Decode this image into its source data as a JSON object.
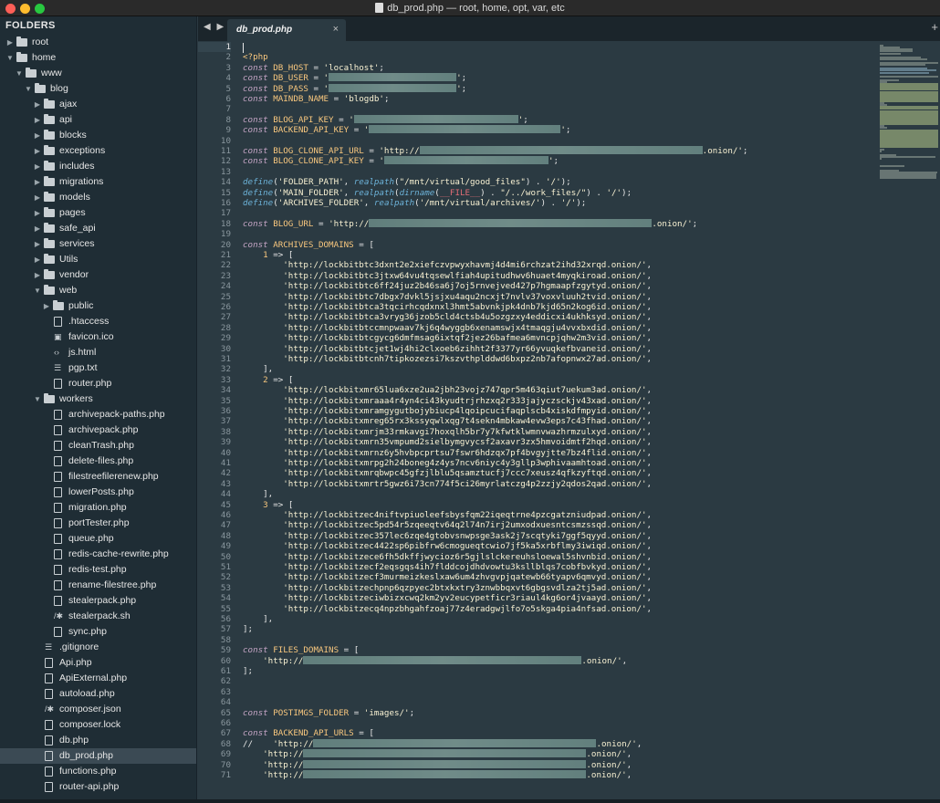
{
  "window": {
    "title": "db_prod.php — root, home, opt, var, etc",
    "traffic_lights": {
      "close": "#fe5f57",
      "minimize": "#febc2e",
      "zoom": "#28c840"
    }
  },
  "sidebar": {
    "header": "FOLDERS",
    "tree": [
      {
        "label": "root",
        "kind": "folder",
        "open": false,
        "depth": 0
      },
      {
        "label": "home",
        "kind": "folder",
        "open": true,
        "depth": 0
      },
      {
        "label": "www",
        "kind": "folder",
        "open": true,
        "depth": 1
      },
      {
        "label": "blog",
        "kind": "folder",
        "open": true,
        "depth": 2
      },
      {
        "label": "ajax",
        "kind": "folder",
        "open": false,
        "depth": 3
      },
      {
        "label": "api",
        "kind": "folder",
        "open": false,
        "depth": 3
      },
      {
        "label": "blocks",
        "kind": "folder",
        "open": false,
        "depth": 3
      },
      {
        "label": "exceptions",
        "kind": "folder",
        "open": false,
        "depth": 3
      },
      {
        "label": "includes",
        "kind": "folder",
        "open": false,
        "depth": 3
      },
      {
        "label": "migrations",
        "kind": "folder",
        "open": false,
        "depth": 3
      },
      {
        "label": "models",
        "kind": "folder",
        "open": false,
        "depth": 3
      },
      {
        "label": "pages",
        "kind": "folder",
        "open": false,
        "depth": 3
      },
      {
        "label": "safe_api",
        "kind": "folder",
        "open": false,
        "depth": 3
      },
      {
        "label": "services",
        "kind": "folder",
        "open": false,
        "depth": 3
      },
      {
        "label": "Utils",
        "kind": "folder",
        "open": false,
        "depth": 3
      },
      {
        "label": "vendor",
        "kind": "folder",
        "open": false,
        "depth": 3
      },
      {
        "label": "web",
        "kind": "folder",
        "open": true,
        "depth": 3
      },
      {
        "label": "public",
        "kind": "folder",
        "open": false,
        "depth": 4
      },
      {
        "label": ".htaccess",
        "kind": "file",
        "depth": 4
      },
      {
        "label": "favicon.ico",
        "kind": "image",
        "depth": 4
      },
      {
        "label": "js.html",
        "kind": "code",
        "depth": 4
      },
      {
        "label": "pgp.txt",
        "kind": "text",
        "depth": 4
      },
      {
        "label": "router.php",
        "kind": "file",
        "depth": 4
      },
      {
        "label": "workers",
        "kind": "folder",
        "open": true,
        "depth": 3
      },
      {
        "label": "archivepack-paths.php",
        "kind": "file",
        "depth": 4
      },
      {
        "label": "archivepack.php",
        "kind": "file",
        "depth": 4
      },
      {
        "label": "cleanTrash.php",
        "kind": "file",
        "depth": 4
      },
      {
        "label": "delete-files.php",
        "kind": "file",
        "depth": 4
      },
      {
        "label": "filestreefilerenew.php",
        "kind": "file",
        "depth": 4
      },
      {
        "label": "lowerPosts.php",
        "kind": "file",
        "depth": 4
      },
      {
        "label": "migration.php",
        "kind": "file",
        "depth": 4
      },
      {
        "label": "portTester.php",
        "kind": "file",
        "depth": 4
      },
      {
        "label": "queue.php",
        "kind": "file",
        "depth": 4
      },
      {
        "label": "redis-cache-rewrite.php",
        "kind": "file",
        "depth": 4
      },
      {
        "label": "redis-test.php",
        "kind": "file",
        "depth": 4
      },
      {
        "label": "rename-filestree.php",
        "kind": "file",
        "depth": 4
      },
      {
        "label": "stealerpack.php",
        "kind": "file",
        "depth": 4
      },
      {
        "label": "stealerpack.sh",
        "kind": "script",
        "depth": 4
      },
      {
        "label": "sync.php",
        "kind": "file",
        "depth": 4
      },
      {
        "label": ".gitignore",
        "kind": "text",
        "depth": 3
      },
      {
        "label": "Api.php",
        "kind": "file",
        "depth": 3
      },
      {
        "label": "ApiExternal.php",
        "kind": "file",
        "depth": 3
      },
      {
        "label": "autoload.php",
        "kind": "file",
        "depth": 3
      },
      {
        "label": "composer.json",
        "kind": "script",
        "depth": 3
      },
      {
        "label": "composer.lock",
        "kind": "file",
        "depth": 3
      },
      {
        "label": "db.php",
        "kind": "file",
        "depth": 3
      },
      {
        "label": "db_prod.php",
        "kind": "file",
        "depth": 3,
        "selected": true
      },
      {
        "label": "functions.php",
        "kind": "file",
        "depth": 3
      },
      {
        "label": "router-api.php",
        "kind": "file",
        "depth": 3
      }
    ]
  },
  "tabs": {
    "nav": "◀ ▶",
    "active": {
      "label": "db_prod.php",
      "close": "×"
    },
    "plus": "+"
  },
  "editor": {
    "current_line": 1,
    "lines": [
      [],
      [
        [
          "kw2",
          "<?php"
        ]
      ],
      [
        [
          "kw",
          "const "
        ],
        [
          "var",
          "DB_HOST"
        ],
        [
          "op",
          " = "
        ],
        [
          "str",
          "'localhost'"
        ],
        [
          "op",
          ";"
        ]
      ],
      [
        [
          "kw",
          "const "
        ],
        [
          "var",
          "DB_USER"
        ],
        [
          "op",
          " = "
        ],
        [
          "str",
          "'"
        ],
        [
          "redact",
          "140"
        ],
        [
          "str",
          "'"
        ],
        [
          "op",
          ";"
        ]
      ],
      [
        [
          "kw",
          "const "
        ],
        [
          "var",
          "DB_PASS"
        ],
        [
          "op",
          " = "
        ],
        [
          "str",
          "'"
        ],
        [
          "redact",
          "140"
        ],
        [
          "str",
          "'"
        ],
        [
          "op",
          ";"
        ]
      ],
      [
        [
          "kw",
          "const "
        ],
        [
          "var",
          "MAINDB_NAME"
        ],
        [
          "op",
          " = "
        ],
        [
          "str",
          "'blogdb'"
        ],
        [
          "op",
          ";"
        ]
      ],
      [],
      [
        [
          "kw",
          "const "
        ],
        [
          "var",
          "BLOG_API_KEY"
        ],
        [
          "op",
          " = "
        ],
        [
          "str",
          "'"
        ],
        [
          "redact",
          "180"
        ],
        [
          "str",
          "'"
        ],
        [
          "op",
          ";"
        ]
      ],
      [
        [
          "kw",
          "const "
        ],
        [
          "var",
          "BACKEND_API_KEY"
        ],
        [
          "op",
          " = "
        ],
        [
          "str",
          "'"
        ],
        [
          "redact",
          "210"
        ],
        [
          "str",
          "'"
        ],
        [
          "op",
          ";"
        ]
      ],
      [],
      [
        [
          "kw",
          "const "
        ],
        [
          "var",
          "BLOG_CLONE_API_URL"
        ],
        [
          "op",
          " = "
        ],
        [
          "str",
          "'http://"
        ],
        [
          "redact",
          "310"
        ],
        [
          "str",
          ".onion/'"
        ],
        [
          "op",
          ";"
        ]
      ],
      [
        [
          "kw",
          "const "
        ],
        [
          "var",
          "BLOG_CLONE_API_KEY"
        ],
        [
          "op",
          " = "
        ],
        [
          "str",
          "'"
        ],
        [
          "redact",
          "180"
        ],
        [
          "str",
          "'"
        ],
        [
          "op",
          ";"
        ]
      ],
      [],
      [
        [
          "fn",
          "define"
        ],
        [
          "op",
          "("
        ],
        [
          "str",
          "'FOLDER_PATH'"
        ],
        [
          "op",
          ", "
        ],
        [
          "fn",
          "realpath"
        ],
        [
          "op",
          "("
        ],
        [
          "str",
          "\"/mnt/virtual/good_files\""
        ],
        [
          "op",
          ") . "
        ],
        [
          "str",
          "'/'"
        ],
        [
          "op",
          ");"
        ]
      ],
      [
        [
          "fn",
          "define"
        ],
        [
          "op",
          "("
        ],
        [
          "str",
          "'MAIN_FOLDER'"
        ],
        [
          "op",
          ", "
        ],
        [
          "fn",
          "realpath"
        ],
        [
          "op",
          "("
        ],
        [
          "fn",
          "dirname"
        ],
        [
          "op",
          "("
        ],
        [
          "const",
          "__FILE__"
        ],
        [
          "op",
          ") . "
        ],
        [
          "str",
          "\"/../work_files/\""
        ],
        [
          "op",
          ") . "
        ],
        [
          "str",
          "'/'"
        ],
        [
          "op",
          ");"
        ]
      ],
      [
        [
          "fn",
          "define"
        ],
        [
          "op",
          "("
        ],
        [
          "str",
          "'ARCHIVES_FOLDER'"
        ],
        [
          "op",
          ", "
        ],
        [
          "fn",
          "realpath"
        ],
        [
          "op",
          "("
        ],
        [
          "str",
          "'/mnt/virtual/archives/'"
        ],
        [
          "op",
          ") . "
        ],
        [
          "str",
          "'/'"
        ],
        [
          "op",
          ");"
        ]
      ],
      [],
      [
        [
          "kw",
          "const "
        ],
        [
          "var",
          "BLOG_URL"
        ],
        [
          "op",
          " = "
        ],
        [
          "str",
          "'http://"
        ],
        [
          "redact",
          "310"
        ],
        [
          "str",
          ".onion/'"
        ],
        [
          "op",
          ";"
        ]
      ],
      [],
      [
        [
          "kw",
          "const "
        ],
        [
          "var",
          "ARCHIVES_DOMAINS"
        ],
        [
          "op",
          " = ["
        ]
      ],
      [
        [
          "op",
          "    "
        ],
        [
          "num",
          "1"
        ],
        [
          "op",
          " => ["
        ]
      ],
      [
        [
          "str",
          "        'http://lockbitbtc3dxnt2e2xiefczvpwyxhavmj4d4mi6rchzat2ihd32xrqd.onion/'"
        ],
        [
          "op",
          ","
        ]
      ],
      [
        [
          "str",
          "        'http://lockbitbtc3jtxw64vu4tqsewlfiah4upitudhwv6huaet4myqkiroad.onion/'"
        ],
        [
          "op",
          ","
        ]
      ],
      [
        [
          "str",
          "        'http://lockbitbtc6ff24juz2b46sa6j7oj5rnvejved427p7hgmaapfzgytyd.onion/'"
        ],
        [
          "op",
          ","
        ]
      ],
      [
        [
          "str",
          "        'http://lockbitbtc7dbgx7dvkl5jsjxu4aqu2ncxjt7nvlv37voxvluuh2tvid.onion/'"
        ],
        [
          "op",
          ","
        ]
      ],
      [
        [
          "str",
          "        'http://lockbitbtca3tqcirhcqdxnxl3hmt5abvnkjpk4dnb7kjd65n2kog6id.onion/'"
        ],
        [
          "op",
          ","
        ]
      ],
      [
        [
          "str",
          "        'http://lockbitbtca3vryg36jzob5cld4ctsb4u5ozgzxy4eddicxi4ukhksyd.onion/'"
        ],
        [
          "op",
          ","
        ]
      ],
      [
        [
          "str",
          "        'http://lockbitbtccmnpwaav7kj6q4wyggb6xenamswjx4tmaqgju4vvxbxdid.onion/'"
        ],
        [
          "op",
          ","
        ]
      ],
      [
        [
          "str",
          "        'http://lockbitbtcgycg6dmfmsag6ixtqf2jez26bafmea6mvncpjqhw2m3vid.onion/'"
        ],
        [
          "op",
          ","
        ]
      ],
      [
        [
          "str",
          "        'http://lockbitbtcjet1wj4hi2clxoeb6zihht2f3377yr66yvuqkefbvaneid.onion/'"
        ],
        [
          "op",
          ","
        ]
      ],
      [
        [
          "str",
          "        'http://lockbitbtcnh7tipkozezsi7kszvthplddwd6bxpz2nb7afopnwx27ad.onion/'"
        ],
        [
          "op",
          ","
        ]
      ],
      [
        [
          "op",
          "    ],"
        ]
      ],
      [
        [
          "op",
          "    "
        ],
        [
          "num",
          "2"
        ],
        [
          "op",
          " => ["
        ]
      ],
      [
        [
          "str",
          "        'http://lockbitxmr65lua6xze2ua2jbh23vojz747qpr5m463qiut7uekum3ad.onion/'"
        ],
        [
          "op",
          ","
        ]
      ],
      [
        [
          "str",
          "        'http://lockbitxmraaa4r4yn4ci43kyudtrjrhzxq2r333jajyczsckjv43xad.onion/'"
        ],
        [
          "op",
          ","
        ]
      ],
      [
        [
          "str",
          "        'http://lockbitxmramgygutbojybiucp4lqoipcucifaqplscb4xiskdfmpyid.onion/'"
        ],
        [
          "op",
          ","
        ]
      ],
      [
        [
          "str",
          "        'http://lockbitxmreg65rx3kssyqwlxqg7t4sekn4mbkaw4evw3eps7c43fhad.onion/'"
        ],
        [
          "op",
          ","
        ]
      ],
      [
        [
          "str",
          "        'http://lockbitxmrjm33rmkavgi7hoxqlh5br7y7kfwtklwmnvwazhrmzulxyd.onion/'"
        ],
        [
          "op",
          ","
        ]
      ],
      [
        [
          "str",
          "        'http://lockbitxmrn35vmpumd2sielbymgvycsf2axavr3zx5hmvoidmtf2hqd.onion/'"
        ],
        [
          "op",
          ","
        ]
      ],
      [
        [
          "str",
          "        'http://lockbitxmrnz6y5hvbpcprtsu7fswr6hdzqx7pf4bvgyjtte7bz4flid.onion/'"
        ],
        [
          "op",
          ","
        ]
      ],
      [
        [
          "str",
          "        'http://lockbitxmrpg2h24boneg4z4ys7ncv6niyc4y3gllp3wphivaamhtoad.onion/'"
        ],
        [
          "op",
          ","
        ]
      ],
      [
        [
          "str",
          "        'http://lockbitxmrqbwpc45gfzjlblu5qsamztucfj7ccc7xeusz4qfkzyftqd.onion/'"
        ],
        [
          "op",
          ","
        ]
      ],
      [
        [
          "str",
          "        'http://lockbitxmrtr5gwz6i73cn774f5ci26myrlatczg4p2zzjy2qdos2qad.onion/'"
        ],
        [
          "op",
          ","
        ]
      ],
      [
        [
          "op",
          "    ],"
        ]
      ],
      [
        [
          "op",
          "    "
        ],
        [
          "num",
          "3"
        ],
        [
          "op",
          " => ["
        ]
      ],
      [
        [
          "str",
          "        'http://lockbitzec4niftvpiuoleefsbysfqm22iqeqtrne4pzcgatzniudpad.onion/'"
        ],
        [
          "op",
          ","
        ]
      ],
      [
        [
          "str",
          "        'http://lockbitzec5pd54r5zqeeqtv64q2l74n7irj2umxodxuesntcsmzssqd.onion/'"
        ],
        [
          "op",
          ","
        ]
      ],
      [
        [
          "str",
          "        'http://lockbitzec357lec6zqe4gtobvsnwpsge3ask2j7scqtyki7ggf5qyyd.onion/'"
        ],
        [
          "op",
          ","
        ]
      ],
      [
        [
          "str",
          "        'http://lockbitzec4422sp6pibfrw6cmogueqtcwio7jf5ka5xrbflmy3iwiqd.onion/'"
        ],
        [
          "op",
          ","
        ]
      ],
      [
        [
          "str",
          "        'http://lockbitzece6fh5dkffjwycioz6r5gjlslckereuhsloewal5shvnbid.onion/'"
        ],
        [
          "op",
          ","
        ]
      ],
      [
        [
          "str",
          "        'http://lockbitzecf2eqsgqs4ih7flddcojdhdvowtu3ksllblqs7cobfbvkyd.onion/'"
        ],
        [
          "op",
          ","
        ]
      ],
      [
        [
          "str",
          "        'http://lockbitzecf3murmeizkeslxaw6um4zhvgvpjqatewb66tyapv6qmvyd.onion/'"
        ],
        [
          "op",
          ","
        ]
      ],
      [
        [
          "str",
          "        'http://lockbitzechpnp6qzpyec2btxkxtry3znwbbqxvt6gbgsvdlza2tj5ad.onion/'"
        ],
        [
          "op",
          ","
        ]
      ],
      [
        [
          "str",
          "        'http://lockbitzeciwbizxcwq2km2yv2eucypetficr3riaul4kg6or4jvaayd.onion/'"
        ],
        [
          "op",
          ","
        ]
      ],
      [
        [
          "str",
          "        'http://lockbitzecq4npzbhgahfzoaj77z4eradgwjlfo7o5skga4pia4nfsad.onion/'"
        ],
        [
          "op",
          ","
        ]
      ],
      [
        [
          "op",
          "    ],"
        ]
      ],
      [
        [
          "op",
          "];"
        ]
      ],
      [],
      [
        [
          "kw",
          "const "
        ],
        [
          "var",
          "FILES_DOMAINS"
        ],
        [
          "op",
          " = ["
        ]
      ],
      [
        [
          "str",
          "    'http://"
        ],
        [
          "redact",
          "305"
        ],
        [
          "str",
          ".onion/'"
        ],
        [
          "op",
          ","
        ]
      ],
      [
        [
          "op",
          "];"
        ]
      ],
      [],
      [],
      [],
      [
        [
          "kw",
          "const "
        ],
        [
          "var",
          "POSTIMGS_FOLDER"
        ],
        [
          "op",
          " = "
        ],
        [
          "str",
          "'images/'"
        ],
        [
          "op",
          ";"
        ]
      ],
      [],
      [
        [
          "kw",
          "const "
        ],
        [
          "var",
          "BACKEND_API_URLS"
        ],
        [
          "op",
          " = ["
        ]
      ],
      [
        [
          "op",
          "//    "
        ],
        [
          "str",
          "'http://"
        ],
        [
          "redact",
          "310"
        ],
        [
          "str",
          ".onion/'"
        ],
        [
          "op",
          ","
        ]
      ],
      [
        [
          "str",
          "    'http://"
        ],
        [
          "redact",
          "310"
        ],
        [
          "str",
          ".onion/'"
        ],
        [
          "op",
          ","
        ]
      ],
      [
        [
          "str",
          "    'http://"
        ],
        [
          "redact",
          "310"
        ],
        [
          "str",
          ".onion/'"
        ],
        [
          "op",
          ","
        ]
      ],
      [
        [
          "str",
          "    'http://"
        ],
        [
          "redact",
          "310"
        ],
        [
          "str",
          ".onion/'"
        ],
        [
          "op",
          ","
        ]
      ]
    ]
  }
}
